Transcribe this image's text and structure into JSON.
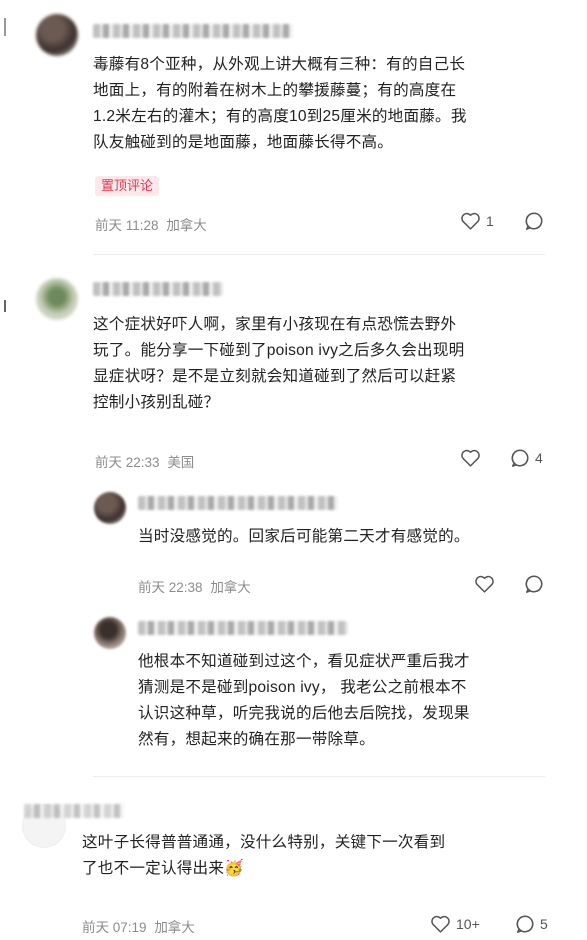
{
  "comments": [
    {
      "text": "毒藤有8个亚种，从外观上讲大概有三种：有的自己长地面上，有的附着在树木上的攀援藤蔓；有的高度在1.2米左右的灌木；有的高度10到25厘米的地面藤。我队友触碰到的是地面藤，地面藤长得不高。",
      "lines": [
        "毒藤有8个亚种，从外观上讲大概有三种：有的自己长",
        "地面上，有的附着在树木上的攀援藤蔓；有的高度在",
        "1.2米左右的灌木；有的高度10到25厘米的地面藤。我",
        "队友触碰到的是地面藤，地面藤长得不高。"
      ],
      "pinned_label": "置顶评论",
      "time": "前天 11:28",
      "location": "加拿大",
      "likes": "1",
      "replies": ""
    },
    {
      "lines": [
        "这个症状好吓人啊，家里有小孩现在有点恐慌去野外",
        "玩了。能分享一下碰到了poison ivy之后多久会出现明",
        "显症状呀？是不是立刻就会知道碰到了然后可以赶紧",
        "控制小孩别乱碰？"
      ],
      "time": "前天 22:33",
      "location": "美国",
      "likes": "",
      "replies": "4"
    },
    {
      "lines": [
        "当时没感觉的。回家后可能第二天才有感觉的。"
      ],
      "time": "前天 22:38",
      "location": "加拿大",
      "likes": "",
      "replies": ""
    },
    {
      "lines": [
        "他根本不知道碰到过这个，看见症状严重后我才",
        "猜测是不是碰到poison ivy， 我老公之前根本不",
        "认识这种草，听完我说的后他去后院找，发现果",
        "然有，想起来的确在那一带除草。"
      ]
    },
    {
      "lines": [
        "这叶子长得普普通通，没什么特别，关键下一次看到",
        "了也不一定认得出来🥳"
      ],
      "time": "前天 07:19",
      "location": "加拿大",
      "likes": "10+",
      "replies": "5"
    }
  ],
  "icons": [
    "heart-icon",
    "comment-bubble-icon"
  ],
  "colors": {
    "pinned_bg": "#fde8ec",
    "pinned_text": "#e8364f",
    "meta": "#8c8c8c"
  }
}
